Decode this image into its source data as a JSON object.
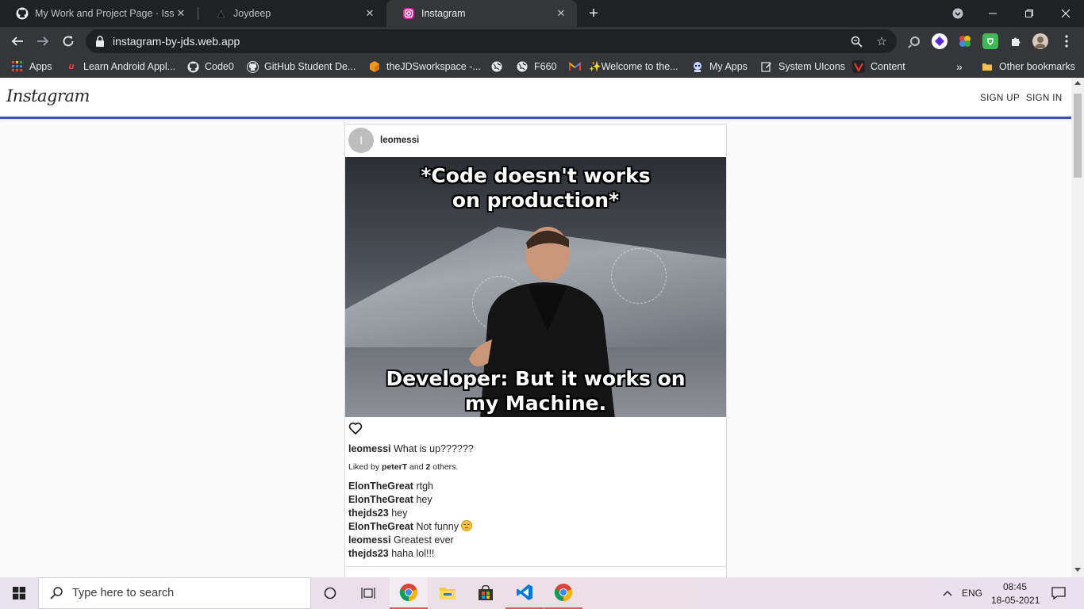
{
  "browser": {
    "tabs": [
      {
        "label": "My Work and Project Page · Issue",
        "icon": "github-icon"
      },
      {
        "label": "Joydeep",
        "icon": "joydeep-icon"
      },
      {
        "label": "Instagram",
        "icon": "instagram-icon"
      }
    ],
    "url": "instagram-by-jds.web.app",
    "bookmarks": [
      {
        "label": "Apps"
      },
      {
        "label": "Learn Android Appl..."
      },
      {
        "label": "Code0"
      },
      {
        "label": "GitHub Student De..."
      },
      {
        "label": "theJDSworkspace -..."
      },
      {
        "label": ""
      },
      {
        "label": "F660"
      },
      {
        "label": ""
      },
      {
        "label": "✨Welcome to the..."
      },
      {
        "label": "My Apps"
      },
      {
        "label": "System UIcons"
      },
      {
        "label": "Content"
      },
      {
        "label": "»"
      },
      {
        "label": "Other bookmarks"
      }
    ]
  },
  "instagram": {
    "logo": "Instagram",
    "nav": {
      "sign_up": "SIGN UP",
      "sign_in": "SIGN IN"
    },
    "post": {
      "avatar_letter": "l",
      "author": "leomessi",
      "meme_top_1": "*Code doesn't works",
      "meme_top_2": "on production*",
      "meme_bottom_1": "Developer: But it works on",
      "meme_bottom_2": "my Machine.",
      "caption_user": "leomessi",
      "caption_text": " What is up??????",
      "likes_prefix": "Liked by ",
      "likes_user": "peterT",
      "likes_mid": " and ",
      "likes_count": "2",
      "likes_suffix": " others.",
      "comments": [
        {
          "user": "ElonTheGreat",
          "text": " rtgh"
        },
        {
          "user": "ElonTheGreat",
          "text": " hey"
        },
        {
          "user": "thejds23",
          "text": " hey"
        },
        {
          "user": "ElonTheGreat",
          "text": " Not funny "
        },
        {
          "user": "leomessi",
          "text": " Greatest ever"
        },
        {
          "user": "thejds23",
          "text": " haha lol!!!"
        }
      ]
    }
  },
  "taskbar": {
    "search_placeholder": "Type here to search",
    "language": "ENG",
    "time": "08:45",
    "date": "18-05-2021"
  }
}
